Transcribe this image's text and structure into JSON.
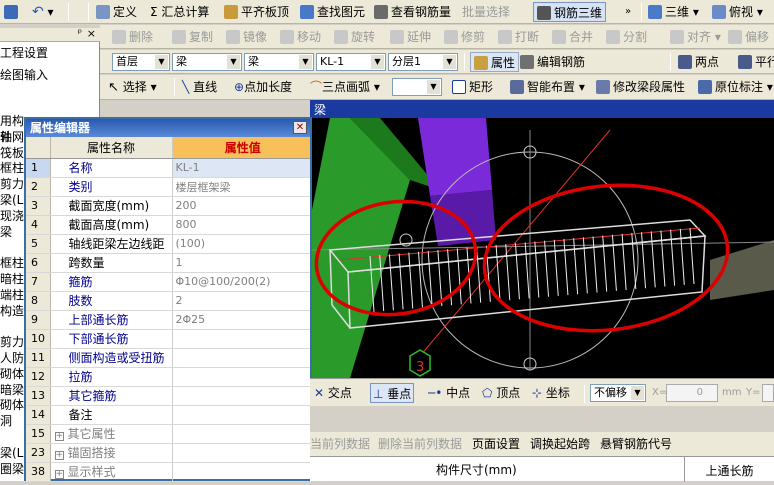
{
  "toolbar1": {
    "items": [
      "定义",
      "Σ 汇总计算",
      "平齐板顶",
      "查找图元",
      "查看钢筋量",
      "批量选择",
      "钢筋三维"
    ],
    "view_3d": "三维",
    "view_top": "俯视"
  },
  "toolbar2": {
    "items": [
      "删除",
      "复制",
      "镜像",
      "移动",
      "旋转",
      "延伸",
      "修剪",
      "打断",
      "合并",
      "分割",
      "对齐",
      "偏移"
    ]
  },
  "toolbar3": {
    "floor": "首层",
    "category": "梁",
    "type": "梁",
    "element": "KL-1",
    "layer": "分层1",
    "property_btn": "属性",
    "edit_rebar_btn": "编辑钢筋",
    "two_point": "两点",
    "parallel": "平行"
  },
  "toolbar4": {
    "select": "选择",
    "line": "直线",
    "point_length": "点加长度",
    "three_arc": "三点画弧",
    "rect": "矩形",
    "smart_layout": "智能布置",
    "modify_beam": "修改梁段属性",
    "in_situ_label": "原位标注"
  },
  "left_panel": {
    "tab_title": "工程设置",
    "tab_drawing": "绘图输入",
    "tree": [
      "用构件",
      "轴网",
      "筏板",
      "框柱",
      "剪力",
      "梁(L",
      "现浇",
      "梁",
      "",
      "框柱",
      "暗柱",
      "端柱",
      "构造",
      "",
      "剪力",
      "人防",
      "砌体",
      "暗梁",
      "砌体",
      "洞",
      "",
      "梁(L",
      "圈梁"
    ]
  },
  "property_editor": {
    "title": "属性编辑器",
    "col_name": "属性名称",
    "col_value": "属性值",
    "rows": [
      {
        "num": "1",
        "name": "名称",
        "value": "KL-1",
        "style": "blue"
      },
      {
        "num": "2",
        "name": "类别",
        "value": "楼层框架梁",
        "style": "blue"
      },
      {
        "num": "3",
        "name": "截面宽度(mm)",
        "value": "200",
        "style": ""
      },
      {
        "num": "4",
        "name": "截面高度(mm)",
        "value": "800",
        "style": ""
      },
      {
        "num": "5",
        "name": "轴线距梁左边线距",
        "value": "(100)",
        "style": ""
      },
      {
        "num": "6",
        "name": "跨数量",
        "value": "1",
        "style": ""
      },
      {
        "num": "7",
        "name": "箍筋",
        "value": "Φ10@100/200(2)",
        "style": "blue"
      },
      {
        "num": "8",
        "name": "肢数",
        "value": "2",
        "style": "blue"
      },
      {
        "num": "9",
        "name": "上部通长筋",
        "value": "2Φ25",
        "style": "blue"
      },
      {
        "num": "10",
        "name": "下部通长筋",
        "value": "",
        "style": "blue"
      },
      {
        "num": "11",
        "name": "侧面构造或受扭筋",
        "value": "",
        "style": "blue"
      },
      {
        "num": "12",
        "name": "拉筋",
        "value": "",
        "style": "blue"
      },
      {
        "num": "13",
        "name": "其它箍筋",
        "value": "",
        "style": "blue"
      },
      {
        "num": "14",
        "name": "备注",
        "value": "",
        "style": ""
      },
      {
        "num": "15",
        "name": "其它属性",
        "value": "",
        "style": "grp"
      },
      {
        "num": "23",
        "name": "锚固搭接",
        "value": "",
        "style": "grp"
      },
      {
        "num": "38",
        "name": "显示样式",
        "value": "",
        "style": "grp"
      }
    ]
  },
  "viewport": {
    "header_partial": "梁",
    "label_3": "3"
  },
  "snapbar": {
    "intersect": "交点",
    "perp": "垂点",
    "mid": "中点",
    "vertex": "顶点",
    "coord": "坐标",
    "offset_mode": "不偏移",
    "x_label": "X=",
    "x_value": "0",
    "unit": "mm",
    "y_label": "Y="
  },
  "gridbar": {
    "insert_row": "当前列数据",
    "delete_row": "删除当前列数据",
    "page_setup": "页面设置",
    "swap_span": "调换起始跨",
    "cantilever": "悬臂钢筋代号"
  },
  "gridhead": {
    "col_size": "构件尺寸(mm)",
    "col_top": "上通长筋"
  }
}
